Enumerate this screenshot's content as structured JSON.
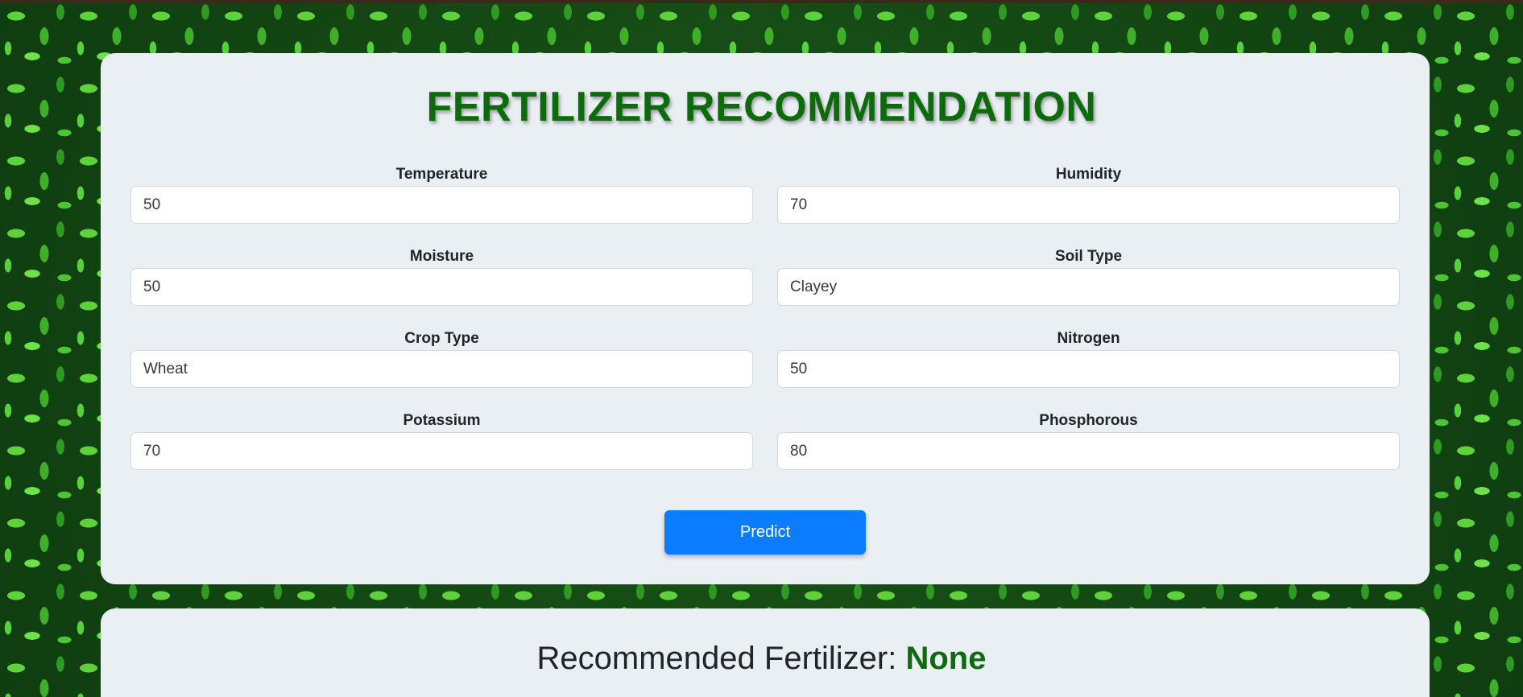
{
  "page": {
    "title": "FERTILIZER RECOMMENDATION"
  },
  "form": {
    "temperature": {
      "label": "Temperature",
      "value": "50"
    },
    "humidity": {
      "label": "Humidity",
      "value": "70"
    },
    "moisture": {
      "label": "Moisture",
      "value": "50"
    },
    "soil_type": {
      "label": "Soil Type",
      "value": "Clayey"
    },
    "crop_type": {
      "label": "Crop Type",
      "value": "Wheat"
    },
    "nitrogen": {
      "label": "Nitrogen",
      "value": "50"
    },
    "potassium": {
      "label": "Potassium",
      "value": "70"
    },
    "phosphorous": {
      "label": "Phosphorous",
      "value": "80"
    },
    "predict_label": "Predict"
  },
  "result": {
    "label": "Recommended Fertilizer: ",
    "value": "None"
  },
  "colors": {
    "accent_green": "#0d6b0d",
    "button_blue": "#0a7cff",
    "card_bg": "#eaeff4"
  }
}
